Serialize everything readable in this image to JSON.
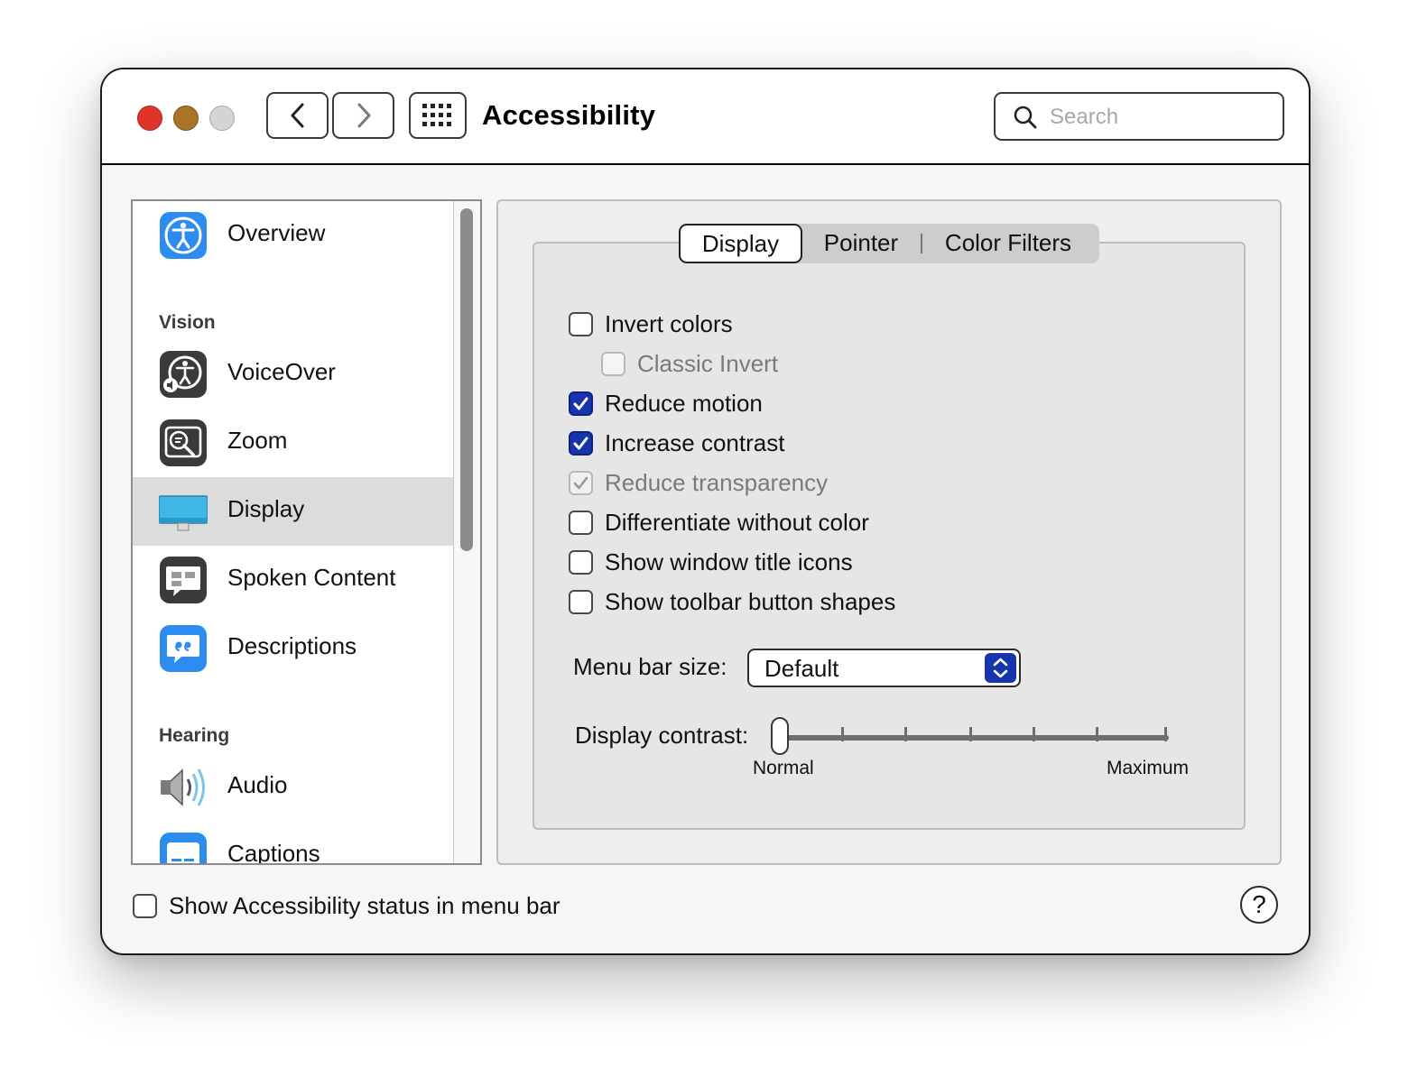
{
  "window": {
    "title": "Accessibility",
    "search": {
      "placeholder": "Search",
      "value": ""
    }
  },
  "sidebar": {
    "items": [
      {
        "label": "Overview",
        "icon": "accessibility-icon"
      },
      {
        "section": "Vision"
      },
      {
        "label": "VoiceOver",
        "icon": "voiceover-icon"
      },
      {
        "label": "Zoom",
        "icon": "zoom-icon"
      },
      {
        "label": "Display",
        "icon": "display-icon",
        "selected": true
      },
      {
        "label": "Spoken Content",
        "icon": "spoken-content-icon"
      },
      {
        "label": "Descriptions",
        "icon": "descriptions-icon"
      },
      {
        "section": "Hearing"
      },
      {
        "label": "Audio",
        "icon": "speaker-icon"
      },
      {
        "label": "Captions",
        "icon": "captions-icon"
      }
    ]
  },
  "tabs": [
    {
      "label": "Display",
      "active": true
    },
    {
      "label": "Pointer",
      "active": false
    },
    {
      "label": "Color Filters",
      "active": false
    }
  ],
  "options": [
    {
      "label": "Invert colors",
      "checked": false,
      "enabled": true
    },
    {
      "label": "Classic Invert",
      "checked": false,
      "enabled": false
    },
    {
      "label": "Reduce motion",
      "checked": true,
      "enabled": true
    },
    {
      "label": "Increase contrast",
      "checked": true,
      "enabled": true
    },
    {
      "label": "Reduce transparency",
      "checked": true,
      "enabled": false
    },
    {
      "label": "Differentiate without color",
      "checked": false,
      "enabled": true
    },
    {
      "label": "Show window title icons",
      "checked": false,
      "enabled": true
    },
    {
      "label": "Show toolbar button shapes",
      "checked": false,
      "enabled": true
    }
  ],
  "menu_bar_size": {
    "label": "Menu bar size:",
    "value": "Default"
  },
  "display_contrast": {
    "label": "Display contrast:",
    "min_label": "Normal",
    "max_label": "Maximum",
    "value": 0
  },
  "footer": {
    "status_checkbox": {
      "label": "Show Accessibility status in menu bar",
      "checked": false
    },
    "help_label": "?"
  },
  "colors": {
    "accent": "#1635ad",
    "close": "#e0342b",
    "minimize": "#a87527",
    "zoom": "#d4d4d4",
    "selection": "#dcdcdc"
  }
}
